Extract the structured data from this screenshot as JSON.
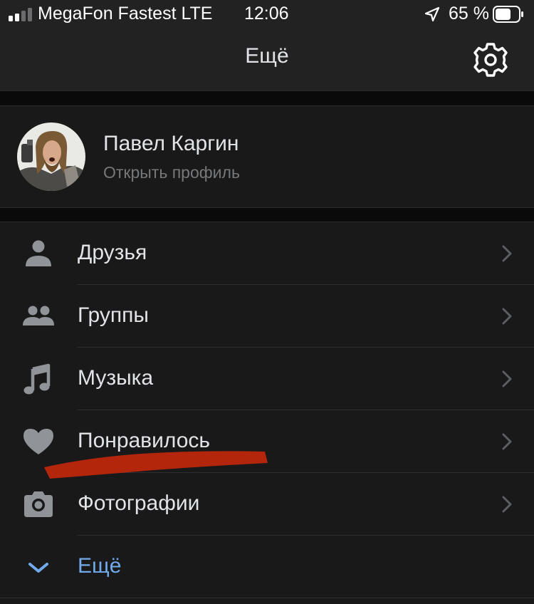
{
  "status_bar": {
    "carrier": "MegaFon Fastest LTE",
    "time": "12:06",
    "battery_percent": "65 %",
    "signal_bars_active": 2,
    "signal_bars_total": 4,
    "battery_level": 0.65
  },
  "nav": {
    "title": "Ещё",
    "settings_icon": "gear-icon"
  },
  "profile": {
    "name": "Павел Каргин",
    "subtitle": "Открыть профиль"
  },
  "menu": {
    "items": [
      {
        "label": "Друзья",
        "icon": "person-icon"
      },
      {
        "label": "Группы",
        "icon": "people-icon"
      },
      {
        "label": "Музыка",
        "icon": "music-note-icon"
      },
      {
        "label": "Понравилось",
        "icon": "heart-icon"
      },
      {
        "label": "Фотографии",
        "icon": "camera-icon"
      }
    ],
    "more": {
      "label": "Ещё",
      "icon": "chevron-down-icon"
    }
  },
  "colors": {
    "background": "#000000",
    "header": "#222222",
    "cell": "#19191a",
    "text_primary": "#e1e3e6",
    "text_secondary": "#76787a",
    "icon": "#909499",
    "accent": "#71aaeb",
    "annotation": "#c8280a"
  }
}
